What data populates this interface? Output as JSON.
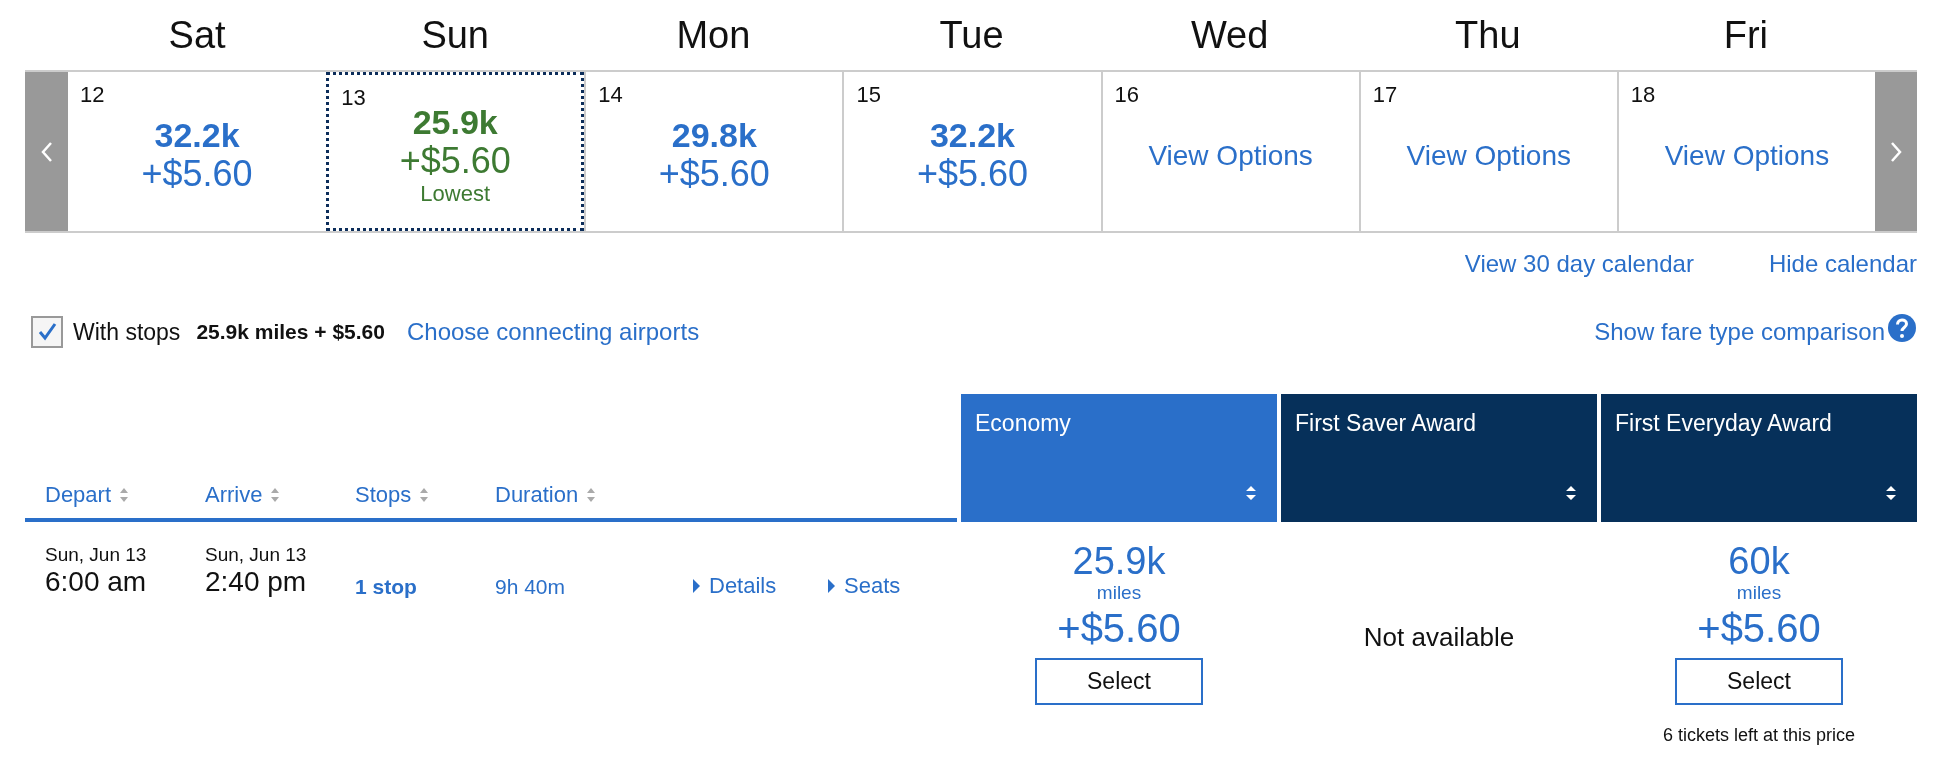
{
  "days": [
    {
      "weekday": "Sat",
      "date": "12",
      "kind": "price",
      "miles": "32.2k",
      "fee": "+$5.60",
      "selected": false,
      "lowest": false
    },
    {
      "weekday": "Sun",
      "date": "13",
      "kind": "price",
      "miles": "25.9k",
      "fee": "+$5.60",
      "note": "Lowest",
      "selected": true,
      "lowest": true
    },
    {
      "weekday": "Mon",
      "date": "14",
      "kind": "price",
      "miles": "29.8k",
      "fee": "+$5.60",
      "selected": false,
      "lowest": false
    },
    {
      "weekday": "Tue",
      "date": "15",
      "kind": "price",
      "miles": "32.2k",
      "fee": "+$5.60",
      "selected": false,
      "lowest": false
    },
    {
      "weekday": "Wed",
      "date": "16",
      "kind": "options",
      "link": "View Options",
      "selected": false
    },
    {
      "weekday": "Thu",
      "date": "17",
      "kind": "options",
      "link": "View Options",
      "selected": false
    },
    {
      "weekday": "Fri",
      "date": "18",
      "kind": "options",
      "link": "View Options",
      "selected": false
    }
  ],
  "calendar_links": [
    "View 30 day calendar",
    "Hide calendar"
  ],
  "filter": {
    "label": "With stops",
    "checked": true,
    "price": "25.9k miles + $5.60",
    "link": "Choose connecting airports"
  },
  "fare_comparison_link": "Show fare type comparison",
  "sort_columns": [
    "Depart",
    "Arrive",
    "Stops",
    "Duration"
  ],
  "fare_columns": [
    {
      "label": "Economy",
      "selected": true
    },
    {
      "label": "First Saver Award",
      "selected": false
    },
    {
      "label": "First Everyday Award",
      "selected": false
    }
  ],
  "flights": [
    {
      "depart_date": "Sun, Jun 13",
      "depart_time": "6:00 am",
      "arrive_date": "Sun, Jun 13",
      "arrive_time": "2:40 pm",
      "stops": "1 stop",
      "duration": "9h 40m",
      "details": "Details",
      "seats": "Seats",
      "fares": [
        {
          "kind": "price",
          "miles": "25.9k",
          "unit": "miles",
          "fee": "+$5.60",
          "button": "Select"
        },
        {
          "kind": "unavailable",
          "text": "Not available"
        },
        {
          "kind": "price",
          "miles": "60k",
          "unit": "miles",
          "fee": "+$5.60",
          "button": "Select",
          "note": "6 tickets left at this price"
        }
      ]
    }
  ]
}
